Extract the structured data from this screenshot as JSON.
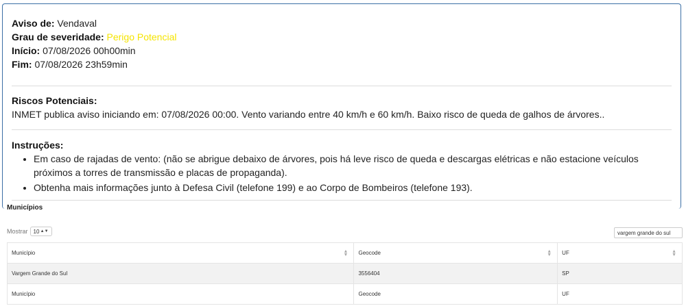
{
  "alert": {
    "aviso_label": "Aviso de:",
    "aviso_value": "Vendaval",
    "severidade_label": "Grau de severidade:",
    "severidade_value": "Perigo Potencial",
    "severidade_color": "#f5e400",
    "inicio_label": "Início:",
    "inicio_value": "07/08/2026 00h00min",
    "fim_label": "Fim:",
    "fim_value": "07/08/2026 23h59min",
    "riscos_title": "Riscos Potenciais:",
    "riscos_text": "INMET publica aviso iniciando em: 07/08/2026 00:00. Vento variando entre 40 km/h e 60 km/h. Baixo risco de queda de galhos de árvores..",
    "instrucoes_title": "Instruções:",
    "instrucoes": [
      "Em caso de rajadas de vento: (não se abrigue debaixo de árvores, pois há leve risco de queda e descargas elétricas e não estacione veículos próximos a torres de transmissão e placas de propaganda).",
      "Obtenha mais informações junto à Defesa Civil (telefone 199) e ao Corpo de Bombeiros (telefone 193)."
    ]
  },
  "municipios": {
    "title": "Municípios",
    "mostrar_label": "Mostrar",
    "page_size": "10",
    "search_value": "vargem grande do sul",
    "columns": [
      "Município",
      "Geocode",
      "UF"
    ],
    "rows": [
      [
        "Vargem Grande do Sul",
        "3556404",
        "SP"
      ]
    ],
    "footer": [
      "Município",
      "Geocode",
      "UF"
    ]
  },
  "colors": {
    "card_border": "#3a6ea5",
    "row_stripe": "#f2f2f2"
  }
}
